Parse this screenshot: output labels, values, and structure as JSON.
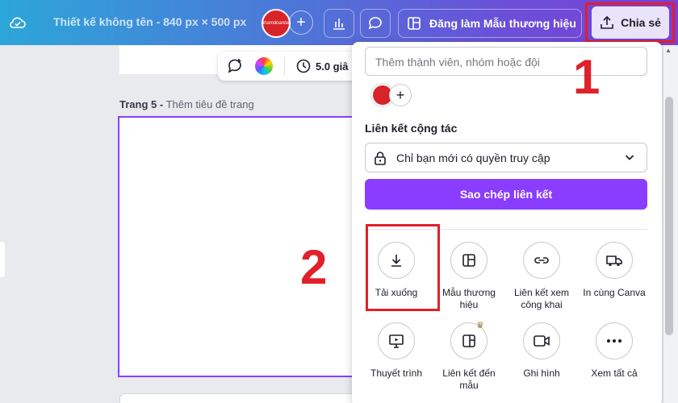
{
  "topbar": {
    "doc_title": "Thiết kế không tên - 840 px × 500 px",
    "avatar_text": "nhamdoanlan",
    "add_label": "+",
    "brand_label": "Đăng làm Mẫu thương hiệu",
    "share_label": "Chia sẻ"
  },
  "canvas": {
    "duration": "5.0 giâ",
    "page_title": "Trang 5 -",
    "page_subtitle": " Thêm tiêu đề trang"
  },
  "share_panel": {
    "member_placeholder": "Thêm thành viên, nhóm hoặc đội",
    "add_label": "+",
    "section_title": "Liên kết cộng tác",
    "access_value": "Chỉ bạn mới có quyền truy cập",
    "copy_button": "Sao chép liên kết",
    "options": [
      {
        "label": "Tải xuống",
        "icon": "download-icon"
      },
      {
        "label": "Mẫu thương hiệu",
        "icon": "template-icon"
      },
      {
        "label": "Liên kết xem công khai",
        "icon": "link-icon"
      },
      {
        "label": "In cùng Canva",
        "icon": "truck-icon"
      },
      {
        "label": "Thuyết trình",
        "icon": "present-icon"
      },
      {
        "label": "Liên kết đến mẫu",
        "icon": "template-link-icon"
      },
      {
        "label": "Ghi hình",
        "icon": "video-camera-icon"
      },
      {
        "label": "Xem tất cả",
        "icon": "more-icon"
      }
    ]
  },
  "annotations": {
    "step1": "1",
    "step2": "2"
  },
  "colors": {
    "accent": "#8b3dff",
    "highlight": "#e0202a"
  }
}
